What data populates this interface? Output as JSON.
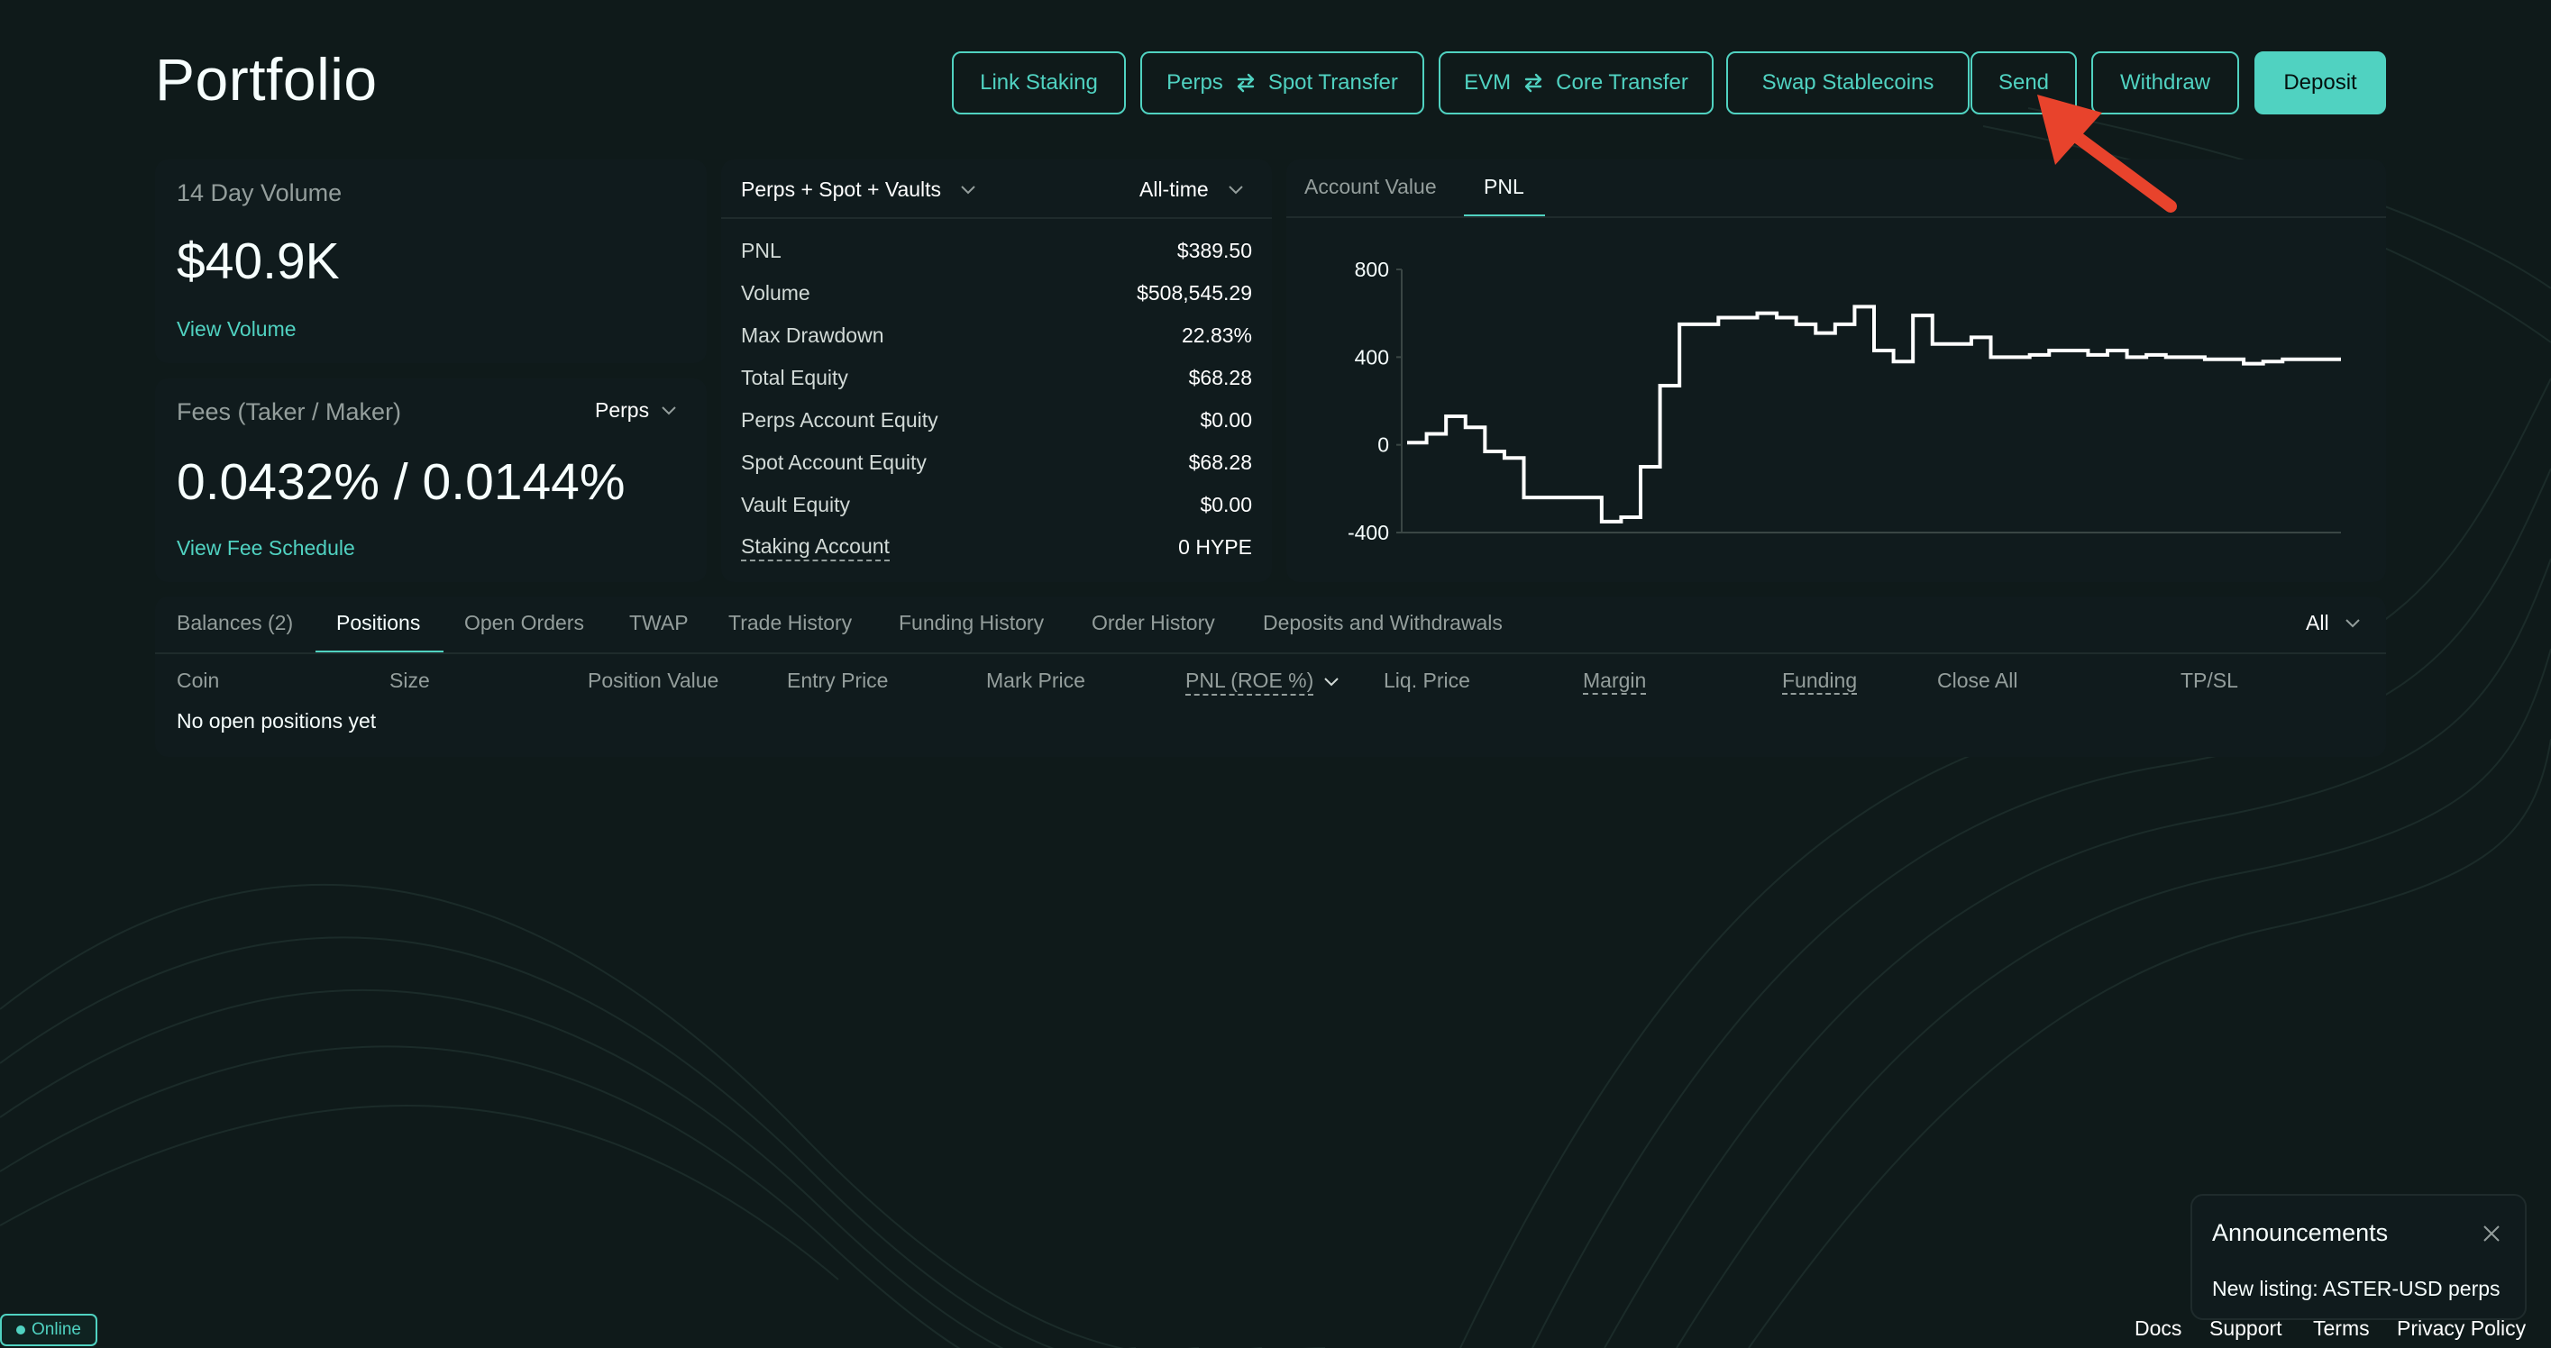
{
  "header": {
    "title": "Portfolio",
    "buttons": {
      "link_staking": "Link Staking",
      "perps_spot_a": "Perps",
      "perps_spot_b": "Spot Transfer",
      "evm_core_a": "EVM",
      "evm_core_b": "Core Transfer",
      "swap_stablecoins": "Swap Stablecoins",
      "send": "Send",
      "withdraw": "Withdraw",
      "deposit": "Deposit"
    }
  },
  "volume_card": {
    "label": "14 Day Volume",
    "value": "$40.9K",
    "link": "View Volume"
  },
  "fees_card": {
    "label": "Fees (Taker / Maker)",
    "selector": "Perps",
    "value": "0.0432% / 0.0144%",
    "link": "View Fee Schedule"
  },
  "stats": {
    "scope_selector": "Perps + Spot + Vaults",
    "time_selector": "All-time",
    "rows": [
      {
        "label": "PNL",
        "value": "$389.50"
      },
      {
        "label": "Volume",
        "value": "$508,545.29"
      },
      {
        "label": "Max Drawdown",
        "value": "22.83%"
      },
      {
        "label": "Total Equity",
        "value": "$68.28"
      },
      {
        "label": "Perps Account Equity",
        "value": "$0.00"
      },
      {
        "label": "Spot Account Equity",
        "value": "$68.28"
      },
      {
        "label": "Vault Equity",
        "value": "$0.00"
      },
      {
        "label": "Staking Account",
        "value": "0 HYPE"
      }
    ]
  },
  "chart_panel": {
    "tabs": [
      "Account Value",
      "PNL"
    ],
    "active_tab": "PNL"
  },
  "chart_data": {
    "type": "line",
    "title": "",
    "xlabel": "",
    "ylabel": "",
    "ylim": [
      -400,
      800
    ],
    "yticks": [
      "800",
      "400",
      "0",
      "-400"
    ],
    "step": true,
    "x": [
      0,
      1,
      2,
      3,
      4,
      5,
      6,
      7,
      8,
      9,
      10,
      11,
      12,
      13,
      14,
      15,
      16,
      17,
      18,
      19,
      20,
      21,
      22,
      23,
      24,
      25,
      26,
      27,
      28,
      29,
      30,
      31,
      32,
      33,
      34,
      35,
      36,
      37,
      38,
      39,
      40,
      41,
      42,
      43,
      44,
      45,
      46,
      47,
      48
    ],
    "values": [
      10,
      50,
      130,
      80,
      -30,
      -60,
      -240,
      -240,
      -240,
      -240,
      -350,
      -330,
      -100,
      270,
      550,
      550,
      580,
      580,
      600,
      580,
      550,
      510,
      550,
      630,
      430,
      380,
      590,
      460,
      460,
      490,
      400,
      400,
      410,
      430,
      430,
      410,
      430,
      400,
      410,
      400,
      400,
      390,
      390,
      370,
      380,
      390,
      390,
      390,
      390
    ]
  },
  "positions_panel": {
    "tabs": [
      "Balances (2)",
      "Positions",
      "Open Orders",
      "TWAP",
      "Trade History",
      "Funding History",
      "Order History",
      "Deposits and Withdrawals"
    ],
    "active_tab": "Positions",
    "filter": "All",
    "columns": [
      "Coin",
      "Size",
      "Position Value",
      "Entry Price",
      "Mark Price",
      "PNL (ROE %)",
      "Liq. Price",
      "Margin",
      "Funding",
      "Close All",
      "TP/SL"
    ],
    "empty_message": "No open positions yet"
  },
  "announcement": {
    "title": "Announcements",
    "body": "New listing: ASTER-USD perps"
  },
  "footer": {
    "status": "Online",
    "links": [
      "Docs",
      "Support",
      "Terms",
      "Privacy Policy"
    ]
  },
  "colors": {
    "accent": "#50d2c1",
    "positive": "#1fa67d",
    "background": "#0f1a1a",
    "panel": "#101b1d",
    "annotation_arrow": "#e8432c"
  }
}
